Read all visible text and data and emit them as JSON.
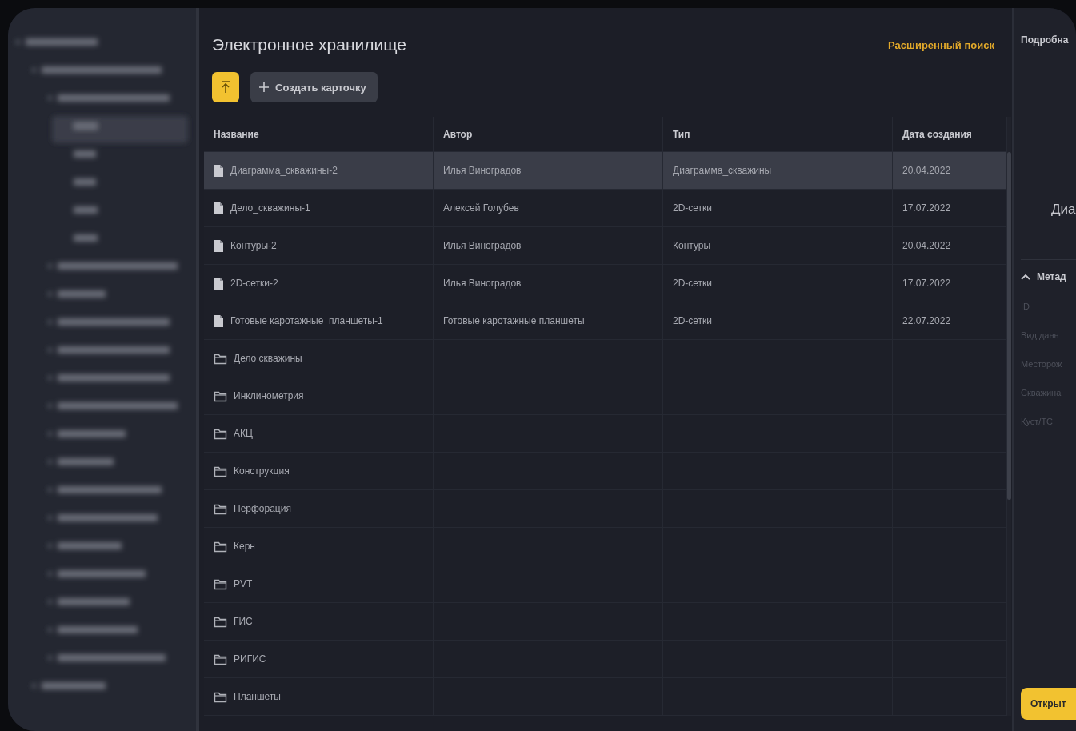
{
  "page": {
    "title": "Электронное хранилище",
    "advanced_search": "Расширенный поиск",
    "create_button": "Создать карточку"
  },
  "table": {
    "columns": [
      "Название",
      "Автор",
      "Тип",
      "Дата создания"
    ],
    "rows": [
      {
        "kind": "file",
        "selected": true,
        "name": "Диаграмма_скважины-2",
        "author": "Илья Виноградов",
        "type": "Диаграмма_скважины",
        "date": "20.04.2022"
      },
      {
        "kind": "file",
        "selected": false,
        "name": "Дело_скважины-1",
        "author": "Алексей Голубев",
        "type": "2D-сетки",
        "date": "17.07.2022"
      },
      {
        "kind": "file",
        "selected": false,
        "name": "Контуры-2",
        "author": "Илья Виноградов",
        "type": "Контуры",
        "date": "20.04.2022"
      },
      {
        "kind": "file",
        "selected": false,
        "name": "2D-сетки-2",
        "author": "Илья Виноградов",
        "type": "2D-сетки",
        "date": "17.07.2022"
      },
      {
        "kind": "file",
        "selected": false,
        "name": "Готовые каротажные_планшеты-1",
        "author": "Готовые каротажные планшеты",
        "type": "2D-сетки",
        "date": "22.07.2022"
      },
      {
        "kind": "folder",
        "selected": false,
        "name": "Дело скважины"
      },
      {
        "kind": "folder",
        "selected": false,
        "name": "Инклинометрия"
      },
      {
        "kind": "folder",
        "selected": false,
        "name": "АКЦ"
      },
      {
        "kind": "folder",
        "selected": false,
        "name": "Конструкция"
      },
      {
        "kind": "folder",
        "selected": false,
        "name": "Перфорация"
      },
      {
        "kind": "folder",
        "selected": false,
        "name": "Керн"
      },
      {
        "kind": "folder",
        "selected": false,
        "name": "PVT"
      },
      {
        "kind": "folder",
        "selected": false,
        "name": "ГИС"
      },
      {
        "kind": "folder",
        "selected": false,
        "name": "РИГИС"
      },
      {
        "kind": "folder",
        "selected": false,
        "name": "Планшеты"
      }
    ]
  },
  "details": {
    "title": "Подробна",
    "preview": "Диа",
    "section": "Метад",
    "section_expanded": true,
    "fields": [
      "ID",
      "Вид данн",
      "Месторож",
      "Скважина",
      "Куст/ТС"
    ],
    "open_button": "Открыт"
  }
}
